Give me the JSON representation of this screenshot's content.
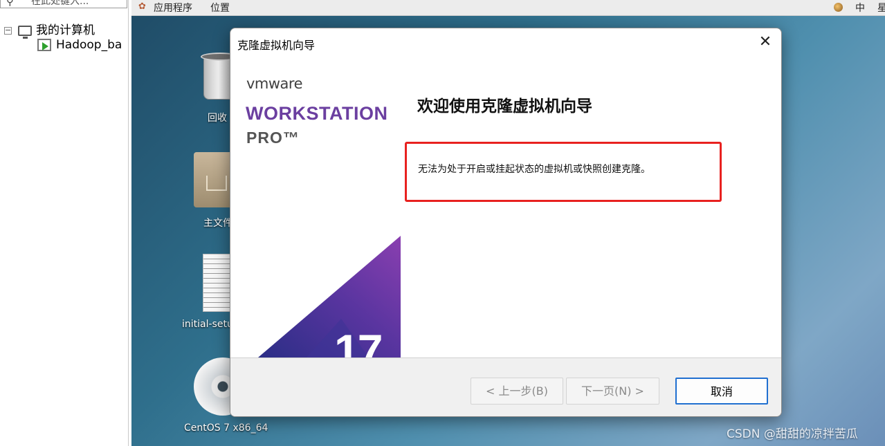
{
  "sidebar": {
    "search_text": "在此处键入...",
    "tree_root_label": "我的计算机",
    "tree_child_label": "Hadoop_ba"
  },
  "guest_topbar": {
    "applications": "应用程序",
    "places": "位置",
    "input_method": "中",
    "day_partial": "星"
  },
  "desktop_icons": {
    "trash": "回收",
    "home": "主文件",
    "doc": "initial-setu",
    "cd": "CentOS 7 x86_64"
  },
  "dialog": {
    "title": "克隆虚拟机向导",
    "brand": {
      "logo": "vmware",
      "product_line1": "WORKSTATION",
      "product_line2": "PRO™",
      "version": "17",
      "colors": {
        "purple": "#6b3fa0",
        "gradient_start": "#2b2e86",
        "gradient_end": "#8a3fb0"
      }
    },
    "heading": "欢迎使用克隆虚拟机向导",
    "message": "无法为处于开启或挂起状态的虚拟机或快照创建克隆。",
    "buttons": {
      "back": "< 上一步(B)",
      "next": "下一页(N) >",
      "cancel": "取消"
    }
  },
  "watermark": "CSDN @甜甜的凉拌苦瓜"
}
